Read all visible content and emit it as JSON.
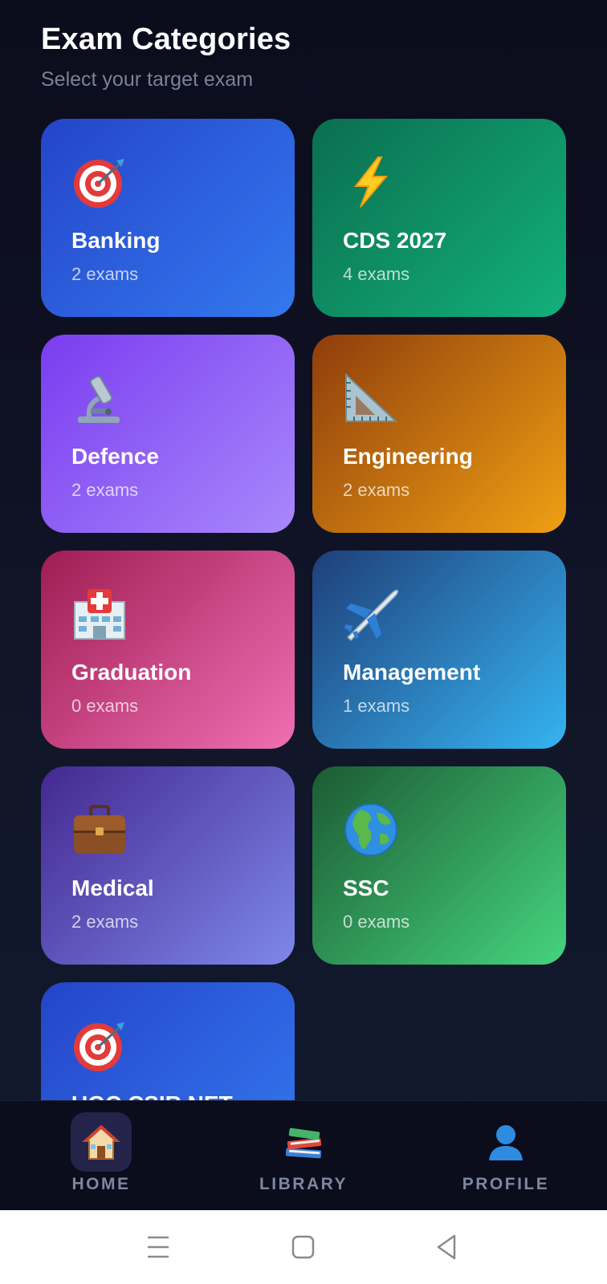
{
  "header": {
    "title": "Exam Categories",
    "subtitle": "Select your target exam"
  },
  "categories": [
    {
      "name": "Banking",
      "count": "2 exams",
      "icon": "target-icon",
      "colors": [
        "#2445c8",
        "#3478ee"
      ]
    },
    {
      "name": "CDS 2027",
      "count": "4 exams",
      "icon": "lightning-icon",
      "colors": [
        "#0b6e4f",
        "#12b07a"
      ]
    },
    {
      "name": "Defence",
      "count": "2 exams",
      "icon": "microscope-icon",
      "colors": [
        "#7a3cf0",
        "#a888fb"
      ]
    },
    {
      "name": "Engineering",
      "count": "2 exams",
      "icon": "triangle-ruler-icon",
      "colors": [
        "#8e3d0c",
        "#f0a012"
      ]
    },
    {
      "name": "Graduation",
      "count": "0 exams",
      "icon": "hospital-icon",
      "colors": [
        "#9e1d52",
        "#f06fb4"
      ]
    },
    {
      "name": "Management",
      "count": "1 exams",
      "icon": "airplane-icon",
      "colors": [
        "#1f3e78",
        "#35b4f2"
      ]
    },
    {
      "name": "Medical",
      "count": "2 exams",
      "icon": "briefcase-icon",
      "colors": [
        "#43288f",
        "#7e87ea"
      ]
    },
    {
      "name": "SSC",
      "count": "0 exams",
      "icon": "globe-icon",
      "colors": [
        "#1c5a33",
        "#45d47e"
      ]
    },
    {
      "name": "UGC CSIR NET",
      "count": "",
      "icon": "target-icon",
      "colors": [
        "#2445c8",
        "#3478ee"
      ]
    }
  ],
  "nav": {
    "home": "HOME",
    "library": "LIBRARY",
    "profile": "PROFILE",
    "active": "home"
  }
}
